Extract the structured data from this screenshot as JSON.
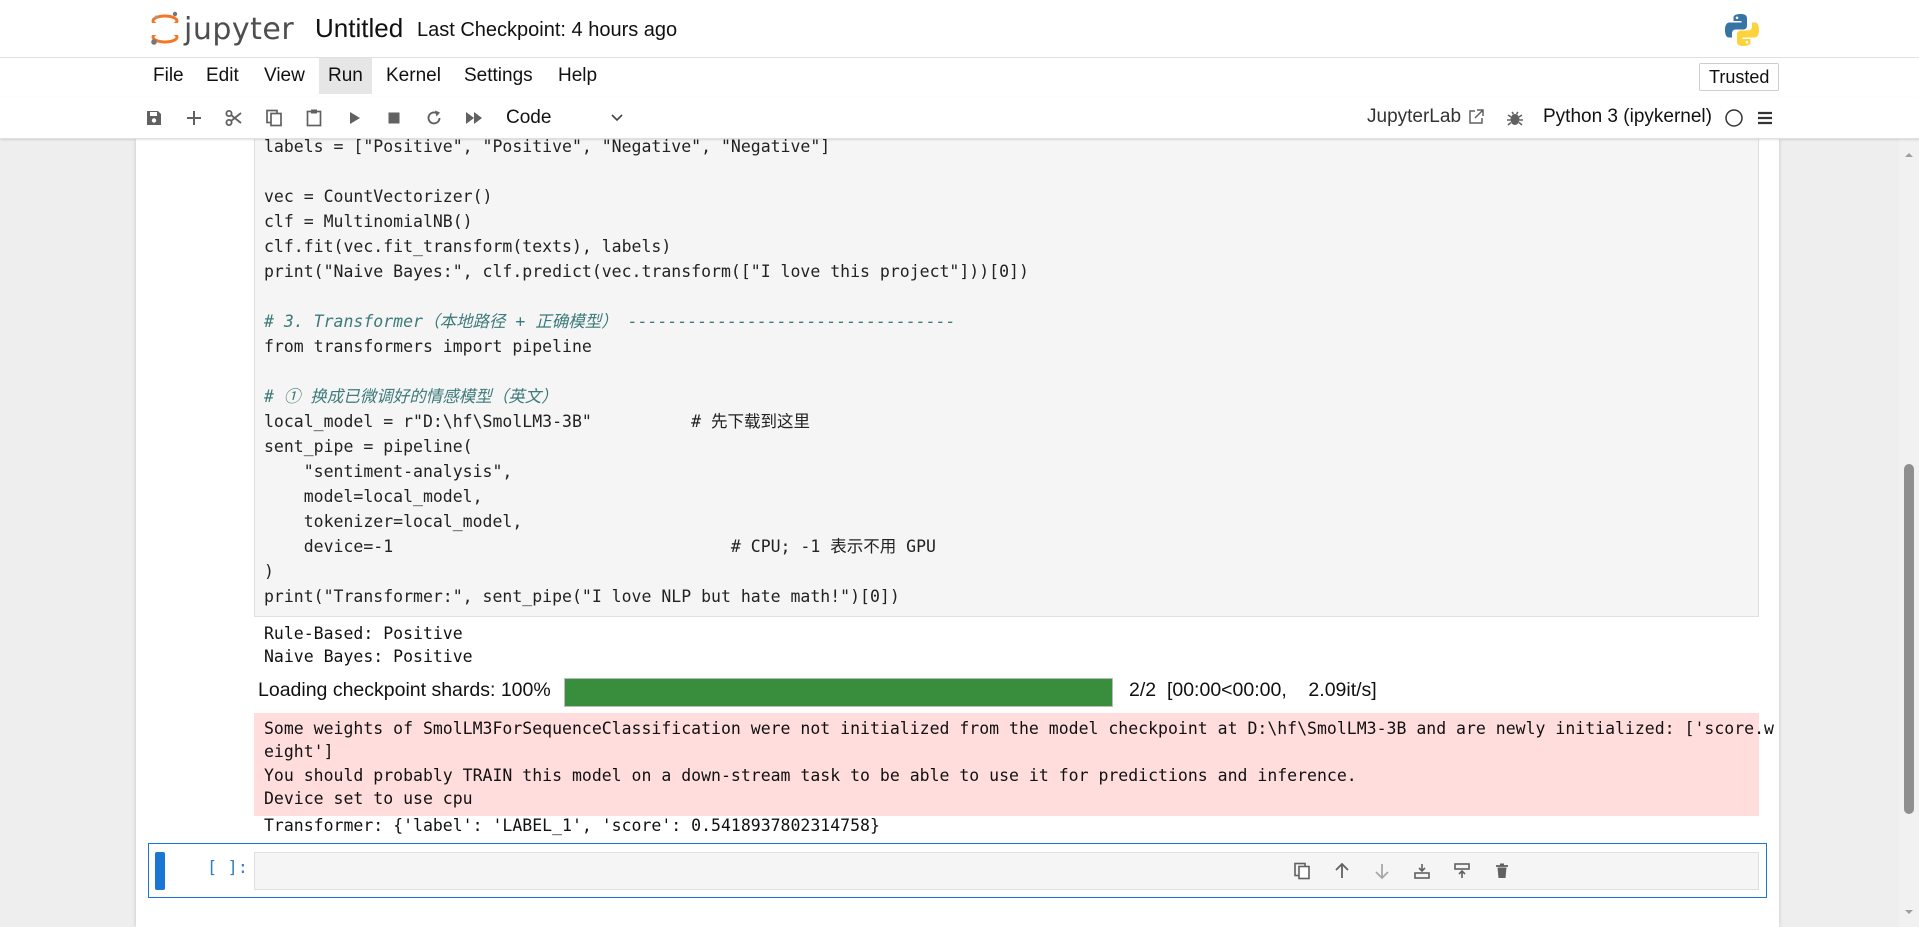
{
  "header": {
    "brand": "jupyter",
    "notebook_title": "Untitled",
    "checkpoint": "Last Checkpoint: 4 hours ago"
  },
  "menu": {
    "items": [
      "File",
      "Edit",
      "View",
      "Run",
      "Kernel",
      "Settings",
      "Help"
    ],
    "active": "Run",
    "trusted": "Trusted"
  },
  "toolbar": {
    "buttons": [
      "save-icon",
      "add-cell-icon",
      "cut-icon",
      "copy-icon",
      "paste-icon",
      "run-icon",
      "stop-icon",
      "restart-icon",
      "run-all-icon"
    ],
    "cell_type": "Code",
    "jupyterlab_link": "JupyterLab",
    "kernel": "Python 3 (ipykernel)"
  },
  "code": {
    "line_labels": "labels = [\"Positive\", \"Positive\", \"Negative\", \"Negative\"]",
    "line_vec": "vec = CountVectorizer()",
    "line_clf": "clf = MultinomialNB()",
    "line_fit": "clf.fit(vec.fit_transform(texts), labels)",
    "line_print_nb": "print(\"Naive Bayes:\", clf.predict(vec.transform([\"I love this project\"]))[0])",
    "line_comment3": "# 3. Transformer（本地路径 + 正确模型） ---------------------------------",
    "line_import": "from transformers import pipeline",
    "line_comment_model": "# ① 换成已微调好的情感模型（英文）",
    "line_local_model": "local_model = r\"D:\\hf\\SmolLM3-3B\"          # 先下载到这里",
    "line_sent_pipe": "sent_pipe = pipeline(",
    "line_task": "    \"sentiment-analysis\",",
    "line_model": "    model=local_model,",
    "line_tokenizer": "    tokenizer=local_model,",
    "line_device": "    device=-1                                  # CPU; -1 表示不用 GPU",
    "line_close": ")",
    "line_print_tf": "print(\"Transformer:\", sent_pipe(\"I love NLP but hate math!\")[0])"
  },
  "output": {
    "rule_based": "Rule-Based: Positive",
    "naive_bayes": "Naive Bayes: Positive",
    "progress_label": "Loading checkpoint shards: 100%",
    "progress_fraction": 1.0,
    "progress_stats": "2/2  [00:00<00:00,    2.09it/s]",
    "stderr_1": "Some weights of SmolLM3ForSequenceClassification were not initialized from the model checkpoint at D:\\hf\\SmolLM3-3B and are newly initialized: ['score.w",
    "stderr_2": "eight']",
    "stderr_3": "You should probably TRAIN this model on a down-stream task to be able to use it for predictions and inference.",
    "stderr_4": "Device set to use cpu",
    "transformer_result": "Transformer: {'label': 'LABEL_1', 'score': 0.5418937802314758}"
  },
  "new_cell": {
    "prompt": "[ ]:",
    "tools": [
      "duplicate-icon",
      "move-up-icon",
      "move-down-icon",
      "insert-above-icon",
      "insert-below-icon",
      "delete-icon"
    ]
  },
  "colors": {
    "accent": "#1976d2",
    "progress": "#388e3c",
    "stderr_bg": "#ffdddd"
  }
}
